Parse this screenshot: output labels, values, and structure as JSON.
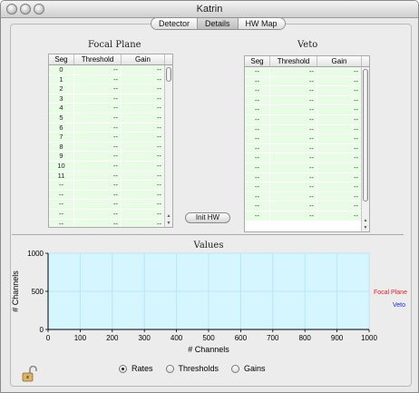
{
  "window": {
    "title": "Katrin"
  },
  "tabs": [
    {
      "label": "Detector",
      "active": false
    },
    {
      "label": "Details",
      "active": true
    },
    {
      "label": "HW Map",
      "active": false
    }
  ],
  "focal_plane": {
    "title": "Focal Plane",
    "columns": [
      "Seg",
      "Threshold",
      "Gain"
    ],
    "rows": [
      [
        "0",
        "--",
        "--"
      ],
      [
        "1",
        "--",
        "--"
      ],
      [
        "2",
        "--",
        "--"
      ],
      [
        "3",
        "--",
        "--"
      ],
      [
        "4",
        "--",
        "--"
      ],
      [
        "5",
        "--",
        "--"
      ],
      [
        "6",
        "--",
        "--"
      ],
      [
        "7",
        "--",
        "--"
      ],
      [
        "8",
        "--",
        "--"
      ],
      [
        "9",
        "--",
        "--"
      ],
      [
        "10",
        "--",
        "--"
      ],
      [
        "11",
        "--",
        "--"
      ],
      [
        "--",
        "--",
        "--"
      ],
      [
        "--",
        "--",
        "--"
      ],
      [
        "--",
        "--",
        "--"
      ],
      [
        "--",
        "--",
        "--"
      ],
      [
        "--",
        "--",
        "--"
      ]
    ]
  },
  "veto": {
    "title": "Veto",
    "columns": [
      "Seg",
      "Threshold",
      "Gain"
    ],
    "rows": [
      [
        "--",
        "--",
        "--"
      ],
      [
        "--",
        "--",
        "--"
      ],
      [
        "--",
        "--",
        "--"
      ],
      [
        "--",
        "--",
        "--"
      ],
      [
        "--",
        "--",
        "--"
      ],
      [
        "--",
        "--",
        "--"
      ],
      [
        "--",
        "--",
        "--"
      ],
      [
        "--",
        "--",
        "--"
      ],
      [
        "--",
        "--",
        "--"
      ],
      [
        "--",
        "--",
        "--"
      ],
      [
        "--",
        "--",
        "--"
      ],
      [
        "--",
        "--",
        "--"
      ],
      [
        "--",
        "--",
        "--"
      ],
      [
        "--",
        "--",
        "--"
      ],
      [
        "--",
        "--",
        "--"
      ],
      [
        "--",
        "--",
        "--"
      ]
    ]
  },
  "init_button": {
    "label": "Init HW"
  },
  "chart_data": {
    "type": "line",
    "title": "Values",
    "xlabel": "# Channels",
    "ylabel": "# Channels",
    "xlim": [
      0,
      1000
    ],
    "ylim": [
      0,
      1000
    ],
    "x_ticks": [
      "0",
      "100",
      "200",
      "300",
      "400",
      "500",
      "600",
      "700",
      "800",
      "900",
      "1000"
    ],
    "y_ticks": [
      "0",
      "500",
      "1000"
    ],
    "grid": true,
    "background": "#d6f6ff",
    "series": [
      {
        "name": "Focal Plane",
        "color": "#e02020",
        "values": []
      },
      {
        "name": "Veto",
        "color": "#2020e0",
        "values": []
      }
    ],
    "legend_position": "right"
  },
  "radio_options": [
    {
      "label": "Rates",
      "selected": true
    },
    {
      "label": "Thresholds",
      "selected": false
    },
    {
      "label": "Gains",
      "selected": false
    }
  ]
}
